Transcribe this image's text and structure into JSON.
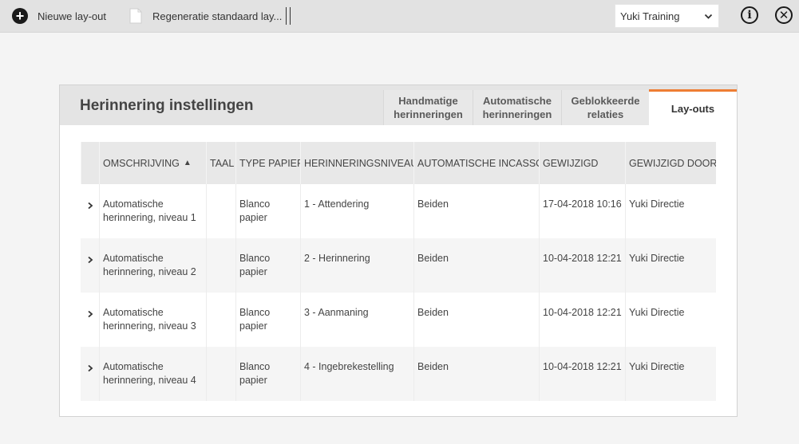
{
  "toolbar": {
    "new_layout_label": "Nieuwe lay-out",
    "regen_label": "Regeneratie standaard lay...",
    "company_select_value": "Yuki Training",
    "icons": {
      "new": "plus-circle-icon",
      "regen": "document-icon",
      "info": "info-icon",
      "close": "close-circle-icon"
    }
  },
  "panel": {
    "title": "Herinnering instellingen",
    "tabs": [
      {
        "label_line1": "Handmatige",
        "label_line2": "herinneringen"
      },
      {
        "label_line1": "Automatische",
        "label_line2": "herinneringen"
      },
      {
        "label_line1": "Geblokkeerde",
        "label_line2": "relaties"
      },
      {
        "label_line1": "Lay-outs",
        "label_line2": ""
      }
    ],
    "active_tab": "Lay-outs",
    "accent_color": "#ee7d33"
  },
  "table": {
    "columns": [
      "OMSCHRIJVING",
      "TAAL",
      "TYPE PAPIER",
      "HERINNERINGSNIVEAU",
      "AUTOMATISCHE INCASSO",
      "GEWIJZIGD",
      "GEWIJZIGD DOOR"
    ],
    "sort_indicator": "▲",
    "rows": [
      {
        "desc1": "Automatische",
        "desc2": "herinnering, niveau 1",
        "taal": "",
        "paper1": "Blanco",
        "paper2": "papier",
        "niveau": "1 - Attendering",
        "incasso": "Beiden",
        "modified": "17-04-2018 10:16",
        "by": "Yuki Directie"
      },
      {
        "desc1": "Automatische",
        "desc2": "herinnering, niveau 2",
        "taal": "",
        "paper1": "Blanco",
        "paper2": "papier",
        "niveau": "2 - Herinnering",
        "incasso": "Beiden",
        "modified": "10-04-2018 12:21",
        "by": "Yuki Directie"
      },
      {
        "desc1": "Automatische",
        "desc2": "herinnering, niveau 3",
        "taal": "",
        "paper1": "Blanco",
        "paper2": "papier",
        "niveau": "3 - Aanmaning",
        "incasso": "Beiden",
        "modified": "10-04-2018 12:21",
        "by": "Yuki Directie"
      },
      {
        "desc1": "Automatische",
        "desc2": "herinnering, niveau 4",
        "taal": "",
        "paper1": "Blanco",
        "paper2": "papier",
        "niveau": "4 - Ingebrekestelling",
        "incasso": "Beiden",
        "modified": "10-04-2018 12:21",
        "by": "Yuki Directie"
      }
    ]
  }
}
